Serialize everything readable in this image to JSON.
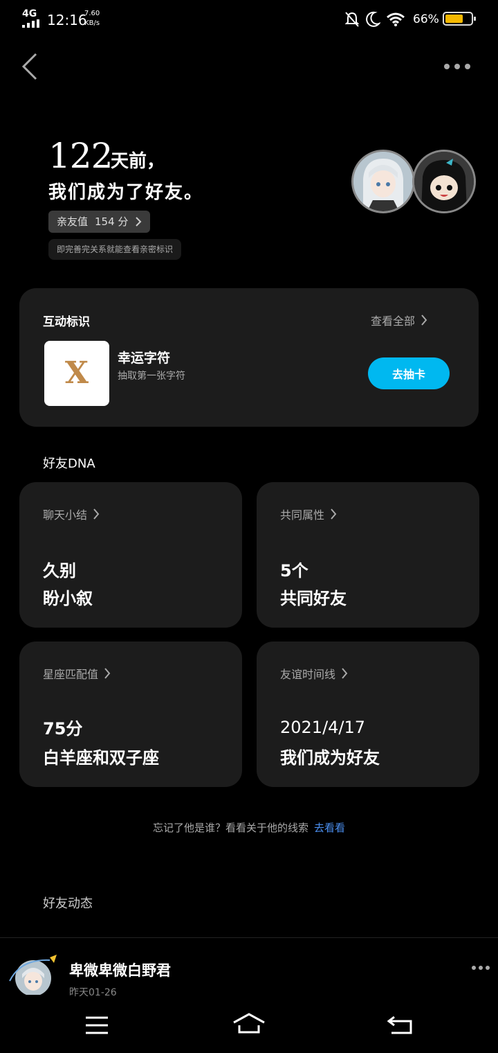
{
  "status_bar": {
    "network": "4G",
    "time": "12:16",
    "speed_value": "7.60",
    "speed_unit": "KB/s",
    "battery": "66%"
  },
  "hero": {
    "days_number": "122",
    "days_suffix": "天前，",
    "became_friends": "我们成为了好友。",
    "intimacy_label": "亲友值",
    "intimacy_value": "154 分",
    "hint": "即完善完关系就能查看亲密标识"
  },
  "interaction_card": {
    "title": "互动标识",
    "view_all": "查看全部",
    "lucky_char": "X",
    "lucky_name": "幸运字符",
    "lucky_sub": "抽取第一张字符",
    "draw_button": "去抽卡"
  },
  "dna": {
    "section_title": "好友DNA",
    "cards": [
      {
        "title": "聊天小结",
        "line1": "久别",
        "line2": "盼小叙"
      },
      {
        "title": "共同属性",
        "line1": "5个",
        "line2": "共同好友"
      },
      {
        "title": "星座匹配值",
        "line1": "75分",
        "line2": "白羊座和双子座"
      },
      {
        "title": "友谊时间线",
        "line1": "2021/4/17",
        "line2": "我们成为好友"
      }
    ]
  },
  "forget_line": {
    "text": "忘记了他是谁？看看关于他的线索",
    "link": "去看看"
  },
  "feed": {
    "section_title": "好友动态",
    "name": "卑微卑微白野君",
    "date": "昨天01-26"
  },
  "colors": {
    "accent": "#00b8f0",
    "link": "#4b8ff0",
    "card_bg": "#1c1c1c",
    "battery_fill": "#f5b800"
  }
}
